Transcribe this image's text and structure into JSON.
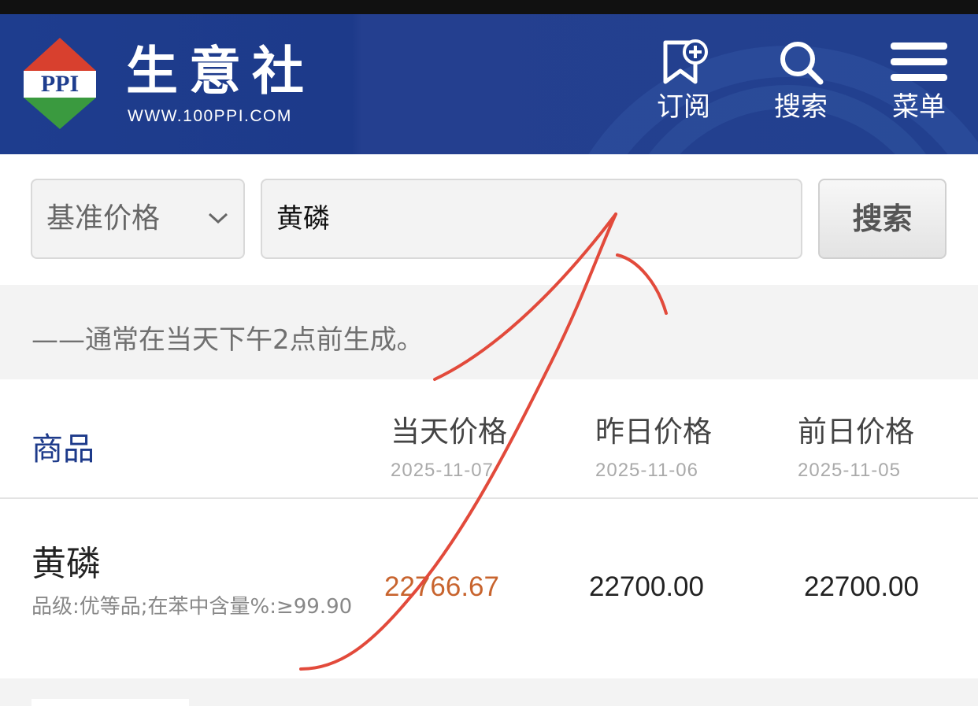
{
  "header": {
    "logo_text": "PPI",
    "brand_name": "生意社",
    "brand_url": "WWW.100PPI.COM",
    "buttons": [
      {
        "label": "订阅",
        "icon": "bookmark-plus-icon"
      },
      {
        "label": "搜索",
        "icon": "search-icon"
      },
      {
        "label": "菜单",
        "icon": "menu-icon"
      }
    ],
    "colors": {
      "bg": "#1e3d8e",
      "logo_red": "#d8402e",
      "logo_green": "#3a9a3f"
    }
  },
  "search": {
    "select_value": "基准价格",
    "input_value": "黄磷",
    "button_label": "搜索"
  },
  "notice": "——通常在当天下午2点前生成。",
  "table": {
    "goods_header": "商品",
    "columns": [
      {
        "title": "当天价格",
        "date": "2025-11-07"
      },
      {
        "title": "昨日价格",
        "date": "2025-11-06"
      },
      {
        "title": "前日价格",
        "date": "2025-11-05"
      }
    ],
    "rows": [
      {
        "name": "黄磷",
        "spec": "品级:优等品;在苯中含量%:≥99.90",
        "today": "22766.67",
        "yesterday": "22700.00",
        "day_before": "22700.00"
      }
    ],
    "highlight_color": "#c8642e"
  }
}
